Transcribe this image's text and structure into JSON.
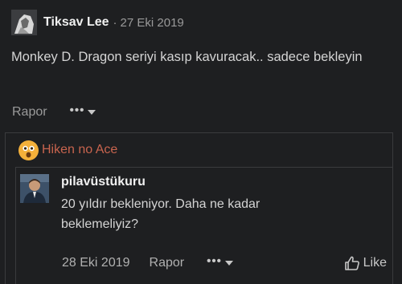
{
  "post": {
    "author": "Tiksav Lee",
    "separator": "·",
    "date": "27 Eki 2019",
    "text": "Monkey D. Dragon seriyi kasıp kavuracak.. sadece bekleyin",
    "report_label": "Rapor",
    "more_label": "•••"
  },
  "quote": {
    "author": "Hiken no Ace",
    "emoji": "shocked-face"
  },
  "reply": {
    "author": "pilavüstükuru",
    "text": "20 yıldır bekleniyor. Daha ne kadar beklemeliyiz?",
    "date": "28 Eki 2019",
    "report_label": "Rapor",
    "more_label": "•••",
    "like_label": "Like"
  },
  "colors": {
    "background": "#1e1f21",
    "quote_name": "#c8644e",
    "border": "#3a3b3d"
  }
}
